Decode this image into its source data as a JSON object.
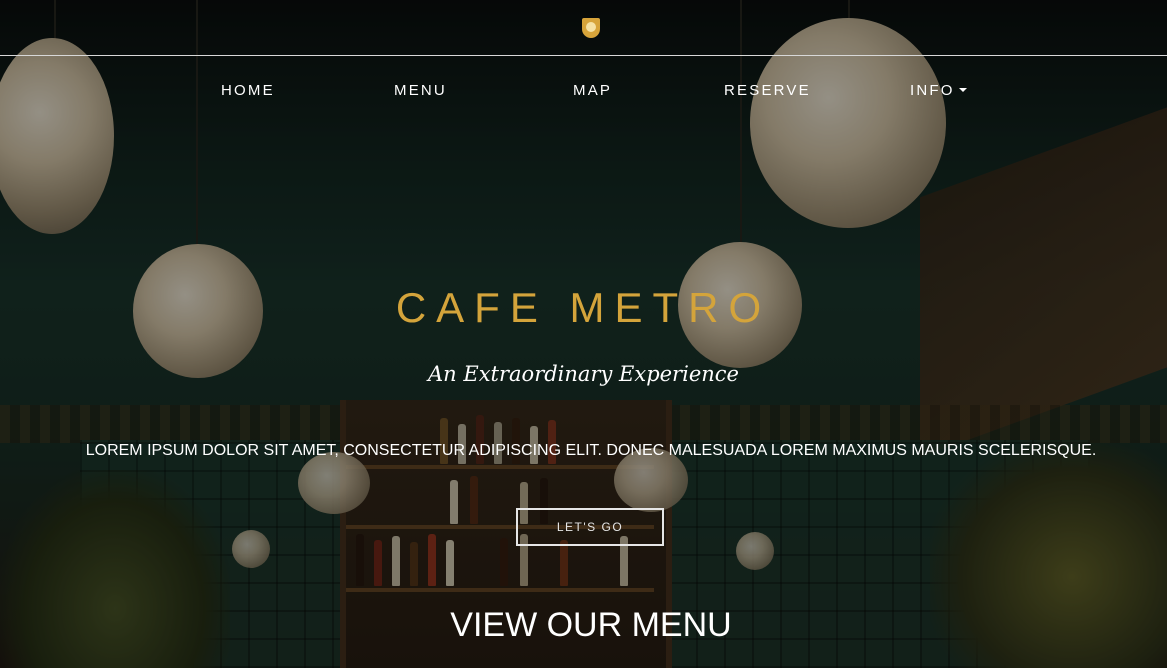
{
  "brand": {
    "logo_icon": "shield-crest-icon",
    "accent": "#d4a43b"
  },
  "nav": {
    "items": [
      {
        "label": "HOME"
      },
      {
        "label": "MENU"
      },
      {
        "label": "MAP"
      },
      {
        "label": "RESERVE"
      },
      {
        "label": "INFO",
        "has_dropdown": true
      }
    ]
  },
  "hero": {
    "title": "CAFE METRO",
    "subtitle": "An Extraordinary Experience",
    "body": "LOREM IPSUM DOLOR SIT AMET, CONSECTETUR ADIPISCING ELIT. DONEC MALESUADA LOREM MAXIMUS MAURIS SCELERISQUE.",
    "cta_label": "LET'S GO"
  },
  "menu_section": {
    "heading": "VIEW OUR MENU"
  }
}
